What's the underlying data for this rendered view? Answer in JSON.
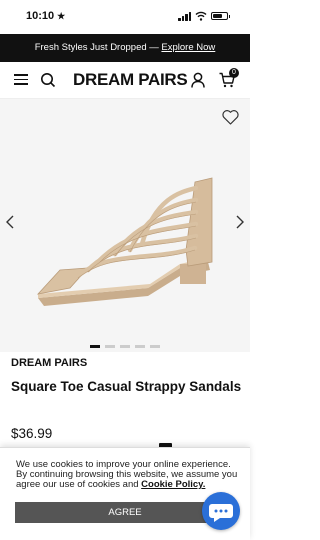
{
  "status_bar": {
    "time": "10:10",
    "location_glyph": "★"
  },
  "promo": {
    "text": "Fresh Styles Just Dropped — ",
    "link": "Explore Now"
  },
  "header": {
    "logo": "DREAM PAIRS",
    "cart_count": "0"
  },
  "product": {
    "brand": "DREAM PAIRS",
    "name": "Square Toe Casual Strappy Sandals",
    "price": "$36.99",
    "gallery": {
      "slide_count": 5,
      "active_slide": 1
    }
  },
  "cookie": {
    "text": "We use cookies to improve your online experience. By continuing browsing this website, we assume you agree our use of cookies and ",
    "policy_link": "Cookie Policy.",
    "agree_label": "AGREE"
  },
  "colors": {
    "accent": "#2a6fd8",
    "promo_bg": "#111111",
    "sandal": "#d9c1a2"
  }
}
